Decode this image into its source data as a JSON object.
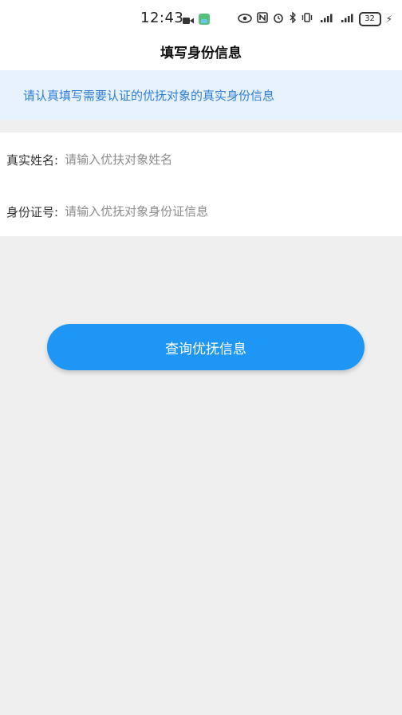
{
  "status_bar": {
    "time": "12:43",
    "battery": "32",
    "icons": [
      "video-icon",
      "app-icon",
      "eye-icon",
      "nfc-icon",
      "alarm-icon",
      "bluetooth-icon",
      "vibrate-icon",
      "signal-5g-icon",
      "signal-4g-icon",
      "charging-icon"
    ]
  },
  "header": {
    "title": "填写身份信息"
  },
  "notice": {
    "text": "请认真填写需要认证的优抚对象的真实身份信息"
  },
  "form": {
    "name_label": "真实姓名:",
    "name_placeholder": "请输入优扶对象姓名",
    "id_label": "身份证号:",
    "id_placeholder": "请输入优抚对象身份证信息"
  },
  "submit_button": {
    "label": "查询优抚信息"
  },
  "colors": {
    "accent": "#1e96f5",
    "notice_bg": "#e8f2ff",
    "notice_text": "#2f7fd7",
    "page_bg": "#efefef"
  }
}
